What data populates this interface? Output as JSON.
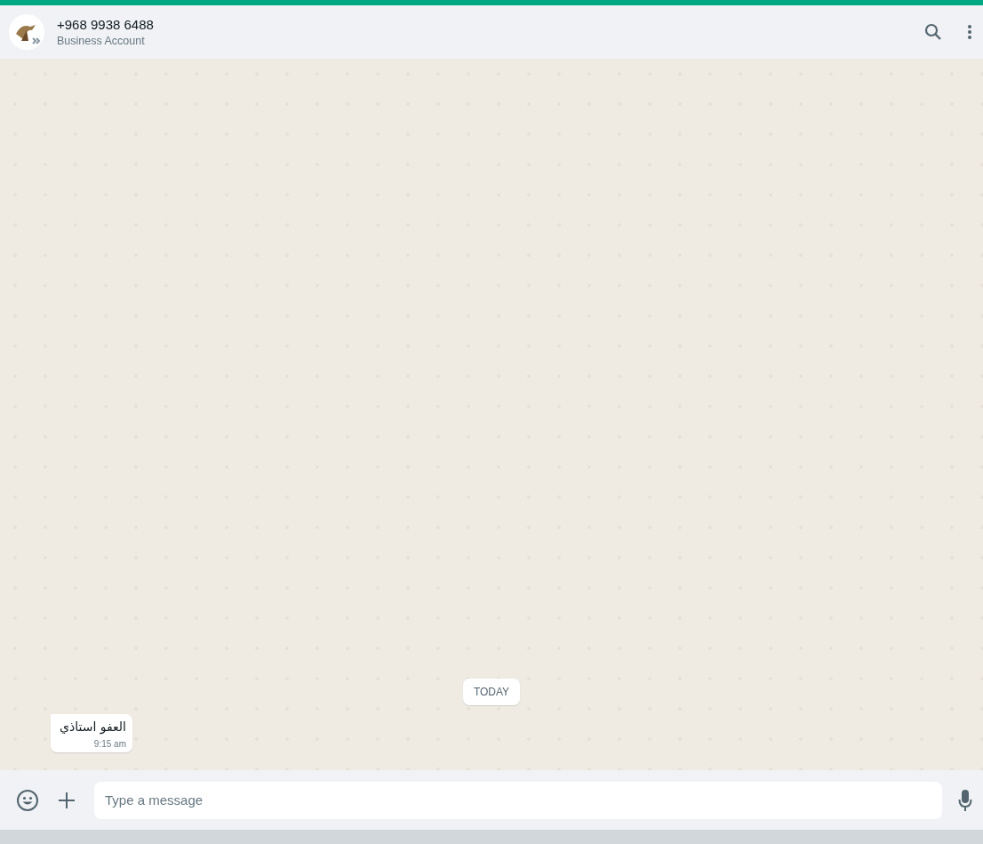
{
  "header": {
    "title": "+968 9938 6488",
    "subtitle": "Business Account"
  },
  "chat": {
    "date_chip": "TODAY",
    "messages": [
      {
        "kind": "incoming",
        "text": "العفو استاذي",
        "time": "9:15 am"
      }
    ]
  },
  "composer": {
    "placeholder": "Type a message"
  }
}
